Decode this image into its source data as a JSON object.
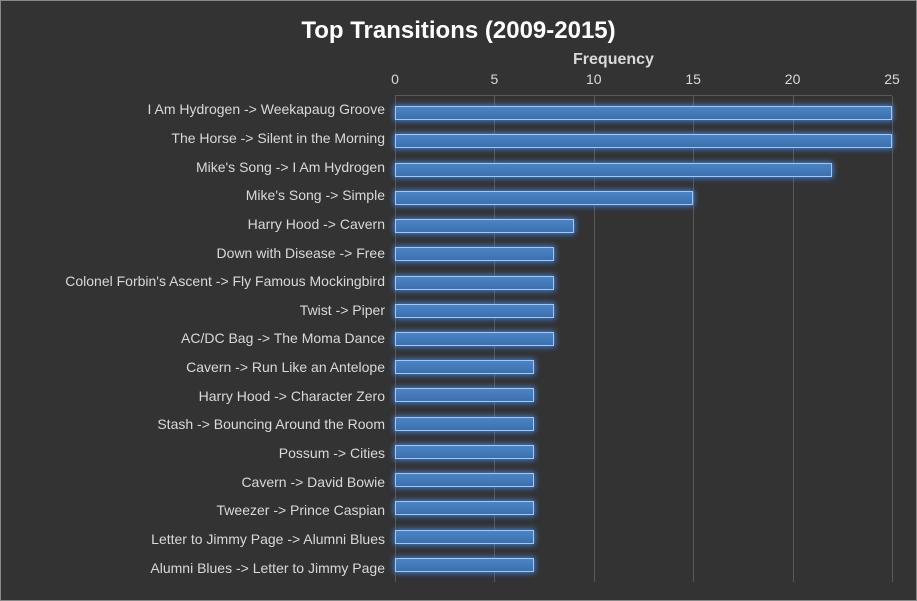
{
  "chart_data": {
    "type": "bar",
    "orientation": "horizontal",
    "title": "Top Transitions (2009-2015)",
    "xlabel": "Frequency",
    "ylabel": "",
    "xlim": [
      0,
      25
    ],
    "x_ticks": [
      0,
      5,
      10,
      15,
      20,
      25
    ],
    "categories": [
      "I Am Hydrogen -> Weekapaug Groove",
      "The Horse -> Silent in the Morning",
      "Mike's Song -> I Am Hydrogen",
      "Mike's Song -> Simple",
      "Harry Hood -> Cavern",
      "Down with Disease -> Free",
      "Colonel Forbin's Ascent -> Fly Famous Mockingbird",
      "Twist -> Piper",
      "AC/DC Bag -> The Moma Dance",
      "Cavern -> Run Like an Antelope",
      "Harry Hood -> Character Zero",
      "Stash -> Bouncing Around the Room",
      "Possum -> Cities",
      "Cavern -> David Bowie",
      "Tweezer -> Prince Caspian",
      "Letter to Jimmy Page -> Alumni Blues",
      "Alumni Blues -> Letter to Jimmy Page"
    ],
    "values": [
      25,
      25,
      22,
      15,
      9,
      8,
      8,
      8,
      8,
      7,
      7,
      7,
      7,
      7,
      7,
      7,
      7
    ],
    "colors": {
      "bar": "#4a84c6",
      "glow": "#5c9be6",
      "grid": "#595959",
      "text": "#d9d9d9"
    }
  }
}
